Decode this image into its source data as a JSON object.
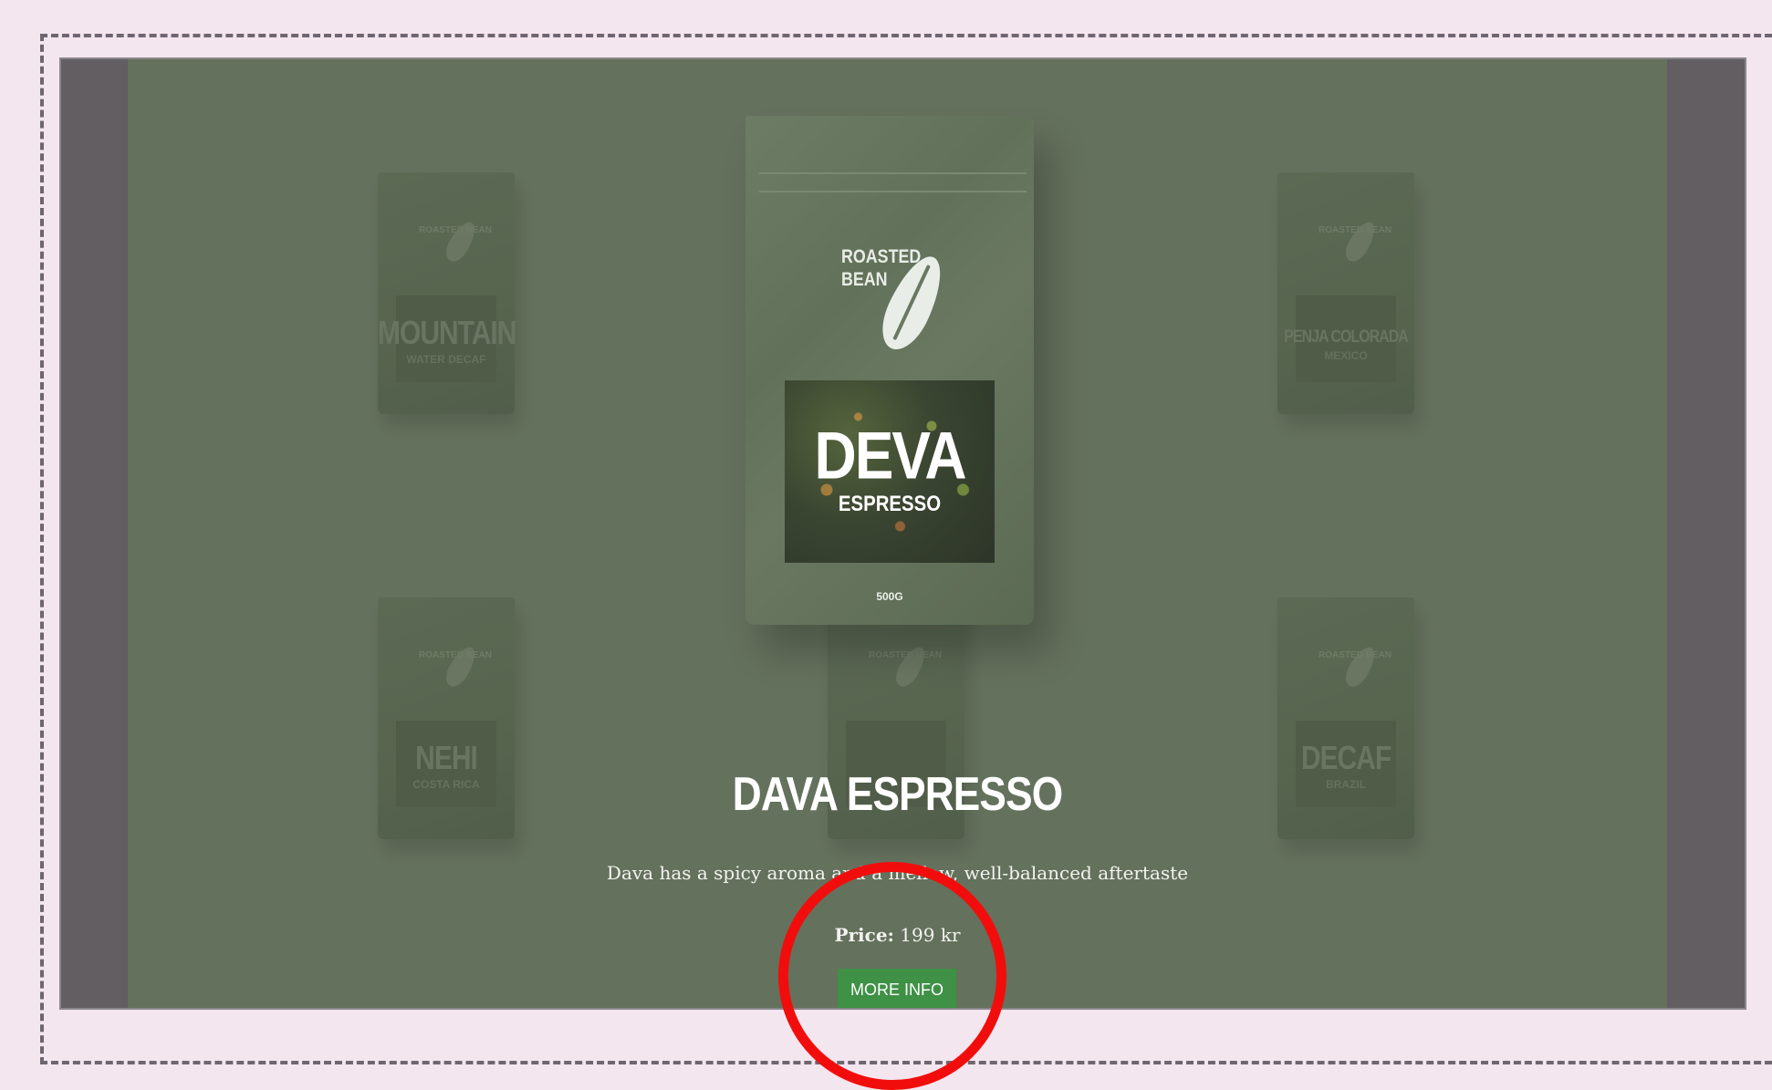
{
  "hero": {
    "title": "DAVA ESPRESSO",
    "description": "Dava has a spicy aroma and a mellow, well-balanced aftertaste",
    "price_label": "Price:",
    "price_value": "199 kr",
    "button_label": "MORE INFO"
  },
  "featured_bag": {
    "brand_line1": "ROASTED",
    "brand_line2": "BEAN",
    "name": "DEVA",
    "subtitle": "ESPRESSO",
    "weight": "500G"
  },
  "background_bags": [
    {
      "brand": "ROASTED BEAN",
      "name": "MOUNTAIN",
      "subtitle": "WATER DECAF"
    },
    {
      "brand": "ROASTED BEAN",
      "name": "PENJA COLORADA",
      "subtitle": "MEXICO"
    },
    {
      "brand": "ROASTED BEAN",
      "name": "NEHI",
      "subtitle": "COSTA RICA"
    },
    {
      "brand": "ROASTED BEAN",
      "name": "",
      "subtitle": ""
    },
    {
      "brand": "ROASTED BEAN",
      "name": "DECAF",
      "subtitle": "BRAZIL"
    }
  ],
  "colors": {
    "page_background": "#f3e6ee",
    "hero_background": "#64715c",
    "side_panel": "#625e62",
    "button": "#3e9145",
    "annotation": "#f20d0d"
  }
}
